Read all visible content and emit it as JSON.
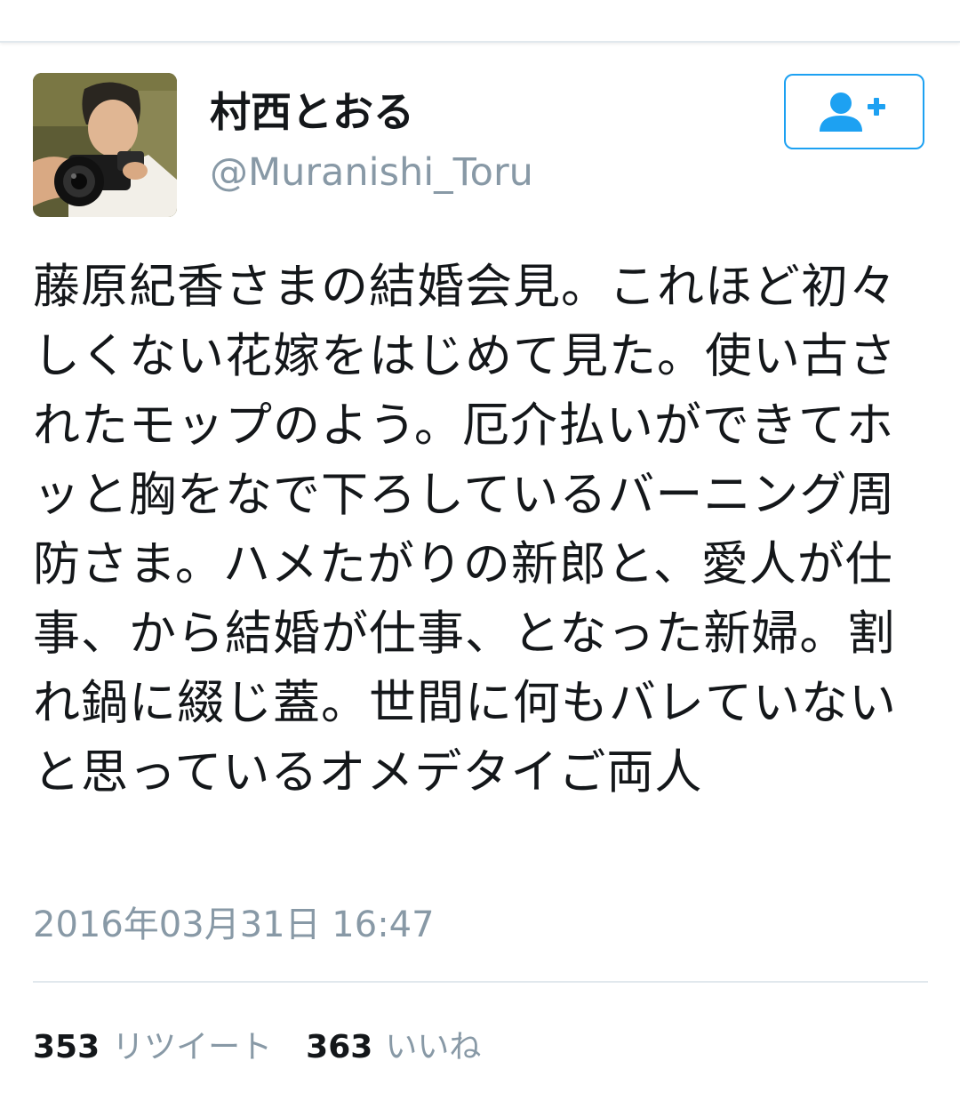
{
  "user": {
    "display_name": "村西とおる",
    "handle": "@Muranishi_Toru",
    "avatar_icon": "user-photo-avatar",
    "follow_icon": "add-user-icon"
  },
  "tweet": {
    "text": "藤原紀香さまの結婚会見。これほど初々しくない花嫁をはじめて見た。使い古されたモップのよう。厄介払いができてホッと胸をなで下ろしているバーニング周防さま。ハメたがりの新郎と、愛人が仕事、から結婚が仕事、となった新婦。割れ鍋に綴じ蓋。世間に何もバレていないと思っているオメデタイご両人",
    "timestamp": "2016年03月31日 16:47"
  },
  "stats": {
    "retweets_count": "353",
    "retweets_label": "リツイート",
    "likes_count": "363",
    "likes_label": "いいね"
  },
  "colors": {
    "accent": "#1da1f2",
    "secondary_text": "#8899a6",
    "divider": "#e1e8ed"
  }
}
